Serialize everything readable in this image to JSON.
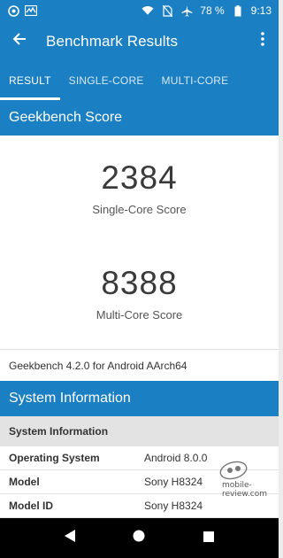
{
  "status_bar": {
    "battery_percent": "78 %",
    "time": "9:13",
    "left_icons": [
      "notification-icon",
      "activity-icon"
    ],
    "right_icons": [
      "wifi-icon",
      "no-sim-icon",
      "airplane-icon",
      "battery-icon"
    ]
  },
  "app_bar": {
    "title": "Benchmark Results"
  },
  "tabs": [
    {
      "label": "RESULT",
      "active": true
    },
    {
      "label": "SINGLE-CORE",
      "active": false
    },
    {
      "label": "MULTI-CORE",
      "active": false
    }
  ],
  "geekbench": {
    "header": "Geekbench Score",
    "single_core": {
      "value": "2384",
      "label": "Single-Core Score"
    },
    "multi_core": {
      "value": "8388",
      "label": "Multi-Core Score"
    },
    "version": "Geekbench 4.2.0 for Android AArch64"
  },
  "system_info": {
    "header": "System Information",
    "subheader": "System Information",
    "rows": [
      {
        "key": "Operating System",
        "value": "Android 8.0.0"
      },
      {
        "key": "Model",
        "value": "Sony H8324"
      },
      {
        "key": "Model ID",
        "value": "Sony H8324"
      }
    ]
  },
  "watermark": {
    "text": "mobile-review.com"
  },
  "colors": {
    "primary": "#1b7fc4",
    "background": "#ececec"
  }
}
